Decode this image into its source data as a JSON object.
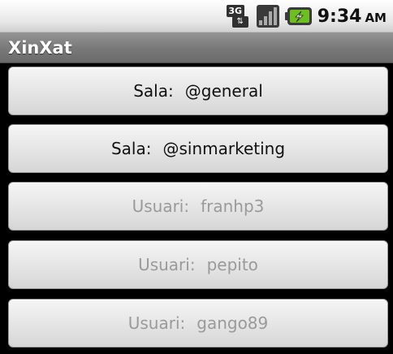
{
  "status_bar": {
    "network_label": "3G",
    "network_arrows": "⇅",
    "time": "9:34",
    "ampm": "AM",
    "battery_color": "#6cbf1e"
  },
  "app": {
    "title": "XinXat"
  },
  "items": [
    {
      "kind": "Sala:",
      "name": "@general",
      "enabled": true
    },
    {
      "kind": "Sala:",
      "name": "@sinmarketing",
      "enabled": true
    },
    {
      "kind": "Usuari:",
      "name": "franhp3",
      "enabled": false
    },
    {
      "kind": "Usuari:",
      "name": "pepito",
      "enabled": false
    },
    {
      "kind": "Usuari:",
      "name": "gango89",
      "enabled": false
    }
  ]
}
